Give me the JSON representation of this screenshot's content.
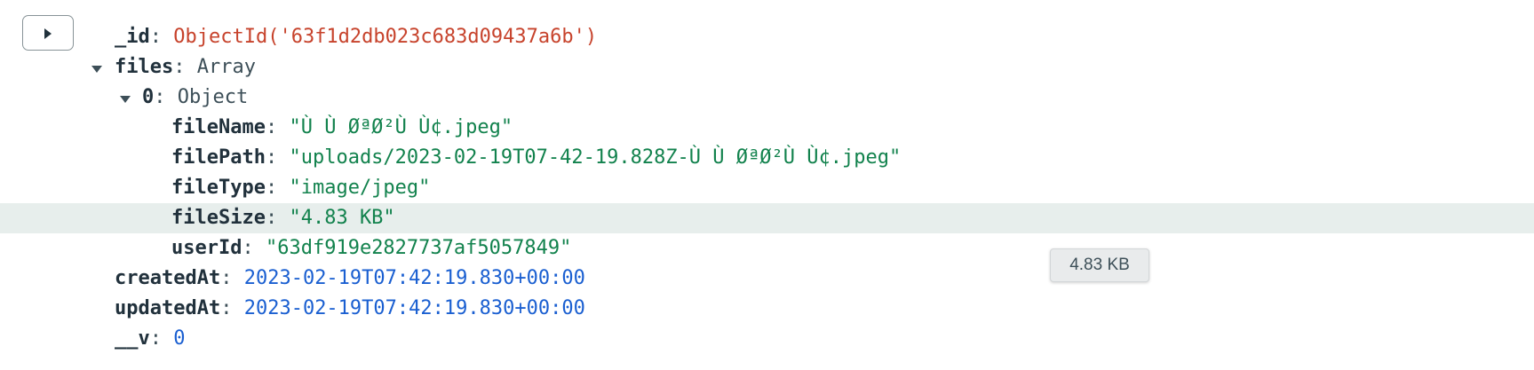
{
  "document": {
    "id": {
      "key": "_id",
      "value": "ObjectId('63f1d2db023c683d09437a6b')"
    },
    "files": {
      "key": "files",
      "type": "Array",
      "items": [
        {
          "key": "0",
          "type": "Object",
          "fields": {
            "fileName": {
              "key": "fileName",
              "value": "\"Ù  Ù  ØªØ²Ù  Ù¢.jpeg\""
            },
            "filePath": {
              "key": "filePath",
              "value": "\"uploads/2023-02-19T07-42-19.828Z-Ù  Ù  ØªØ²Ù  Ù¢.jpeg\""
            },
            "fileType": {
              "key": "fileType",
              "value": "\"image/jpeg\""
            },
            "fileSize": {
              "key": "fileSize",
              "value": "\"4.83 KB\""
            },
            "userId": {
              "key": "userId",
              "value": "\"63df919e2827737af5057849\""
            }
          }
        }
      ]
    },
    "createdAt": {
      "key": "createdAt",
      "value": "2023-02-19T07:42:19.830+00:00"
    },
    "updatedAt": {
      "key": "updatedAt",
      "value": "2023-02-19T07:42:19.830+00:00"
    },
    "v": {
      "key": "__v",
      "value": "0"
    }
  },
  "colon": ":",
  "tooltip": {
    "text": "4.83 KB"
  },
  "icons": {
    "expand": "play-triangle-icon",
    "caret": "caret-down-icon"
  },
  "colors": {
    "objectid": "#c7432c",
    "string": "#12824d",
    "date": "#1a5fd1",
    "number": "#1a5fd1",
    "highlight_row": "#e7eeec"
  }
}
